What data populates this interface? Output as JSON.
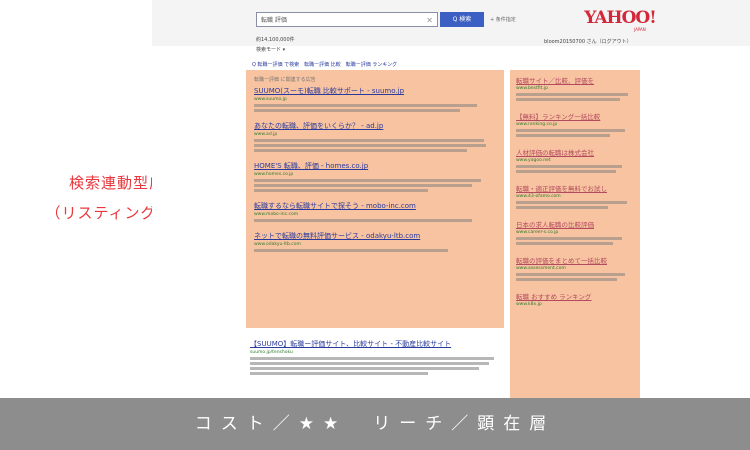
{
  "annotation": {
    "line1": "検索連動型広告",
    "line2": "（リスティング広告）"
  },
  "header": {
    "query": "転職 評価",
    "search_button": "Q 検索",
    "search_option": "+ 条件指定",
    "logo": "YAHOO!",
    "logo_sub": "JAPAN",
    "results_count": "約14,100,000件",
    "user_info": "bloom20150700 さん（ログアウト）",
    "mode": "検索モード ▾",
    "related": "Q 転職ー評価 で検索　転職ー評価 比較　転職ー評価 ランキング"
  },
  "main_ads": {
    "header": "転職ー評価 に関連する広告",
    "items": [
      {
        "title": "SUUMO(スーモ)転職 比較サポート - suumo.jp",
        "url": "www.suumo.jp"
      },
      {
        "title": "あなたの転職、評価をいくらか？ - ad.jp",
        "url": "www.ad.jp"
      },
      {
        "title": "HOME'S 転職、評価 - homes.co.jp",
        "url": "www.homes.co.jp"
      },
      {
        "title": "転職するなら転職サイトで探そう - mobo-inc.com",
        "url": "www.mobo-inc.com"
      },
      {
        "title": "ネットで転職の無料評価サービス - odakyu-ltb.com",
        "url": "www.odakyu-ltb.com"
      }
    ]
  },
  "side_ads": {
    "items": [
      {
        "title": "転職サイト／比較、評価を",
        "url": "www.bestfit.jp"
      },
      {
        "title": "【無料】ランキング一括比較",
        "url": "www.ranking.co.jp"
      },
      {
        "title": "人材評価の転職は株式会社",
        "url": "www.yagoo.net"
      },
      {
        "title": "転職・適正評価を無料でお試し",
        "url": "www.43-ofamo.com"
      },
      {
        "title": "日本の求人転職の比較評価",
        "url": "www.career-s.co.jp"
      },
      {
        "title": "転職の評価をまとめて一括比較",
        "url": "www.assessment.com"
      },
      {
        "title": "転職 おすすめ ランキング",
        "url": "www.k8x.jp"
      }
    ]
  },
  "organic": {
    "title": "【SUUMO】転職ー評価サイト、比較サイト - 不動産比較サイト",
    "url": "suumo.jp/tenshoku"
  },
  "footer_band": "コスト／★★　リーチ／顕在層"
}
